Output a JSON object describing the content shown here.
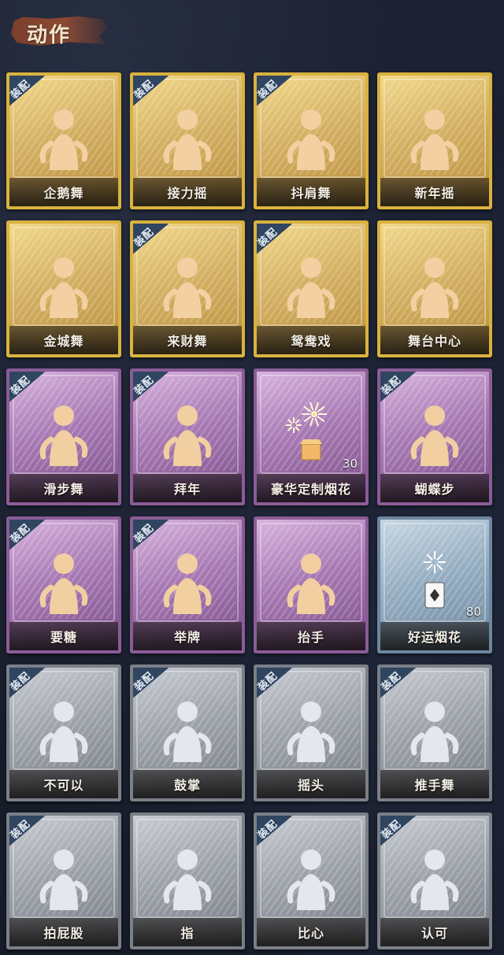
{
  "header": {
    "title": "动作"
  },
  "badge_text": "装配",
  "cards": [
    {
      "label": "企鹅舞",
      "tier": "gold",
      "equipped": true,
      "icon": "penguin-dance-icon"
    },
    {
      "label": "接力摇",
      "tier": "gold",
      "equipped": true,
      "icon": "relay-shake-icon"
    },
    {
      "label": "抖肩舞",
      "tier": "gold",
      "equipped": true,
      "icon": "shoulder-shake-icon"
    },
    {
      "label": "新年摇",
      "tier": "gold",
      "equipped": false,
      "icon": "new-year-shake-icon"
    },
    {
      "label": "金城舞",
      "tier": "gold",
      "equipped": false,
      "icon": "golden-city-dance-icon"
    },
    {
      "label": "来财舞",
      "tier": "gold",
      "equipped": true,
      "icon": "fortune-dance-icon"
    },
    {
      "label": "鸳鸯戏",
      "tier": "gold",
      "equipped": true,
      "icon": "mandarin-duck-icon"
    },
    {
      "label": "舞台中心",
      "tier": "gold",
      "equipped": false,
      "icon": "center-stage-icon"
    },
    {
      "label": "滑步舞",
      "tier": "purple",
      "equipped": true,
      "icon": "slide-dance-icon"
    },
    {
      "label": "拜年",
      "tier": "purple",
      "equipped": true,
      "icon": "new-year-greeting-icon"
    },
    {
      "label": "豪华定制烟花",
      "tier": "purple",
      "equipped": false,
      "icon": "deluxe-fireworks-icon",
      "count": "30"
    },
    {
      "label": "蝴蝶步",
      "tier": "purple",
      "equipped": true,
      "icon": "butterfly-step-icon"
    },
    {
      "label": "要糖",
      "tier": "purple",
      "equipped": true,
      "icon": "ask-candy-icon"
    },
    {
      "label": "举牌",
      "tier": "purple",
      "equipped": true,
      "icon": "hold-sign-icon"
    },
    {
      "label": "抬手",
      "tier": "purple",
      "equipped": false,
      "icon": "raise-hand-icon"
    },
    {
      "label": "好运烟花",
      "tier": "blue",
      "equipped": false,
      "icon": "lucky-fireworks-icon",
      "count": "80"
    },
    {
      "label": "不可以",
      "tier": "gray",
      "equipped": true,
      "icon": "no-finger-icon"
    },
    {
      "label": "鼓掌",
      "tier": "gray",
      "equipped": true,
      "icon": "clap-icon"
    },
    {
      "label": "摇头",
      "tier": "gray",
      "equipped": true,
      "icon": "shake-head-icon"
    },
    {
      "label": "推手舞",
      "tier": "gray",
      "equipped": true,
      "icon": "push-hand-dance-icon"
    },
    {
      "label": "拍屁股",
      "tier": "gray",
      "equipped": true,
      "icon": "butt-slap-icon"
    },
    {
      "label": "指",
      "tier": "gray",
      "equipped": false,
      "icon": "point-icon"
    },
    {
      "label": "比心",
      "tier": "gray",
      "equipped": true,
      "icon": "finger-heart-icon"
    },
    {
      "label": "认可",
      "tier": "gray",
      "equipped": true,
      "icon": "thumbs-up-icon"
    }
  ]
}
